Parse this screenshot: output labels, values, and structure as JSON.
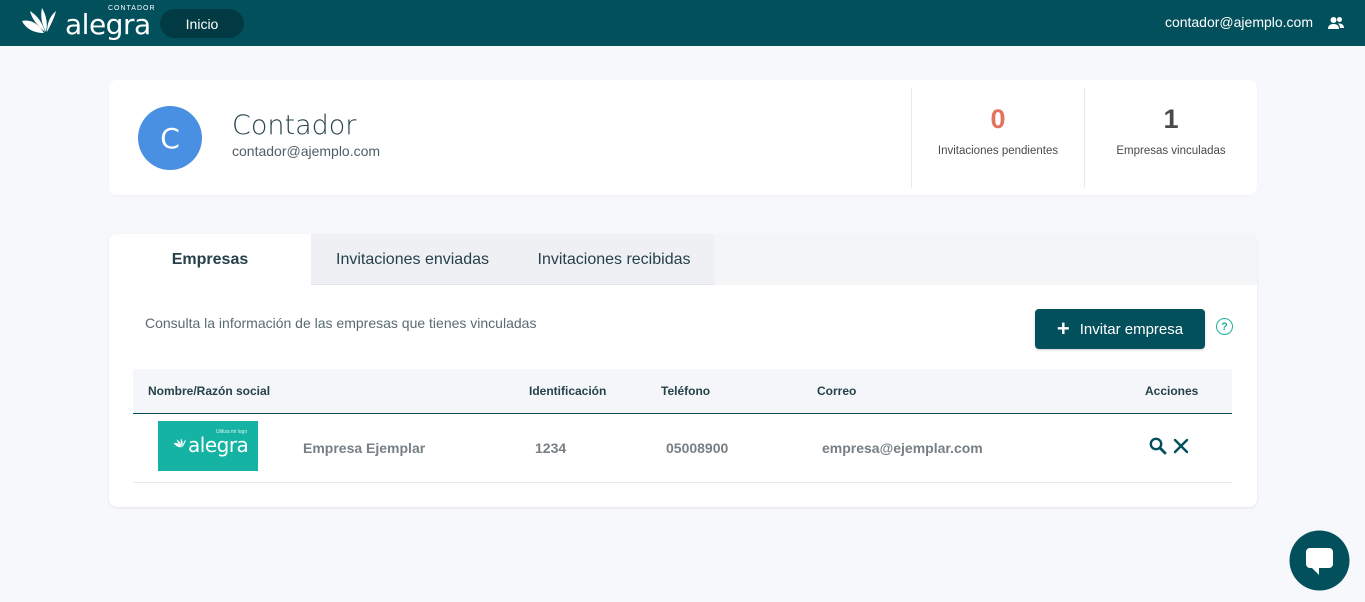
{
  "topbar": {
    "brand_tag": "CONTADOR",
    "brand_name": "alegra",
    "nav_inicio": "Inicio",
    "user_email": "contador@ajemplo.com"
  },
  "profile": {
    "avatar_initial": "C",
    "name": "Contador",
    "email": "contador@ajemplo.com",
    "stats": [
      {
        "value": "0",
        "label": "Invitaciones pendientes"
      },
      {
        "value": "1",
        "label": "Empresas vinculadas"
      }
    ]
  },
  "tabs": [
    {
      "label": "Empresas",
      "active": true
    },
    {
      "label": "Invitaciones enviadas",
      "active": false
    },
    {
      "label": "Invitaciones recibidas",
      "active": false
    }
  ],
  "empresas": {
    "description": "Consulta la información de las empresas que tienes vinculadas",
    "invite_button": "Invitar empresa",
    "help_icon": "?",
    "columns": [
      "Nombre/Razón social",
      "Identificación",
      "Teléfono",
      "Correo",
      "Acciones"
    ],
    "rows": [
      {
        "logo_name": "alegra",
        "logo_tag": "Utiliza mi logo",
        "name": "Empresa Ejemplar",
        "identificacion": "1234",
        "telefono": "05008900",
        "correo": "empresa@ejemplar.com"
      }
    ]
  },
  "icons": {
    "users": "users-icon",
    "search": "search-icon",
    "close": "close-icon",
    "chat": "chat-icon"
  },
  "colors": {
    "primary": "#03505d",
    "accent_teal": "#1fb09d",
    "pending_orange": "#e2725b",
    "avatar_blue": "#4a90e2"
  }
}
